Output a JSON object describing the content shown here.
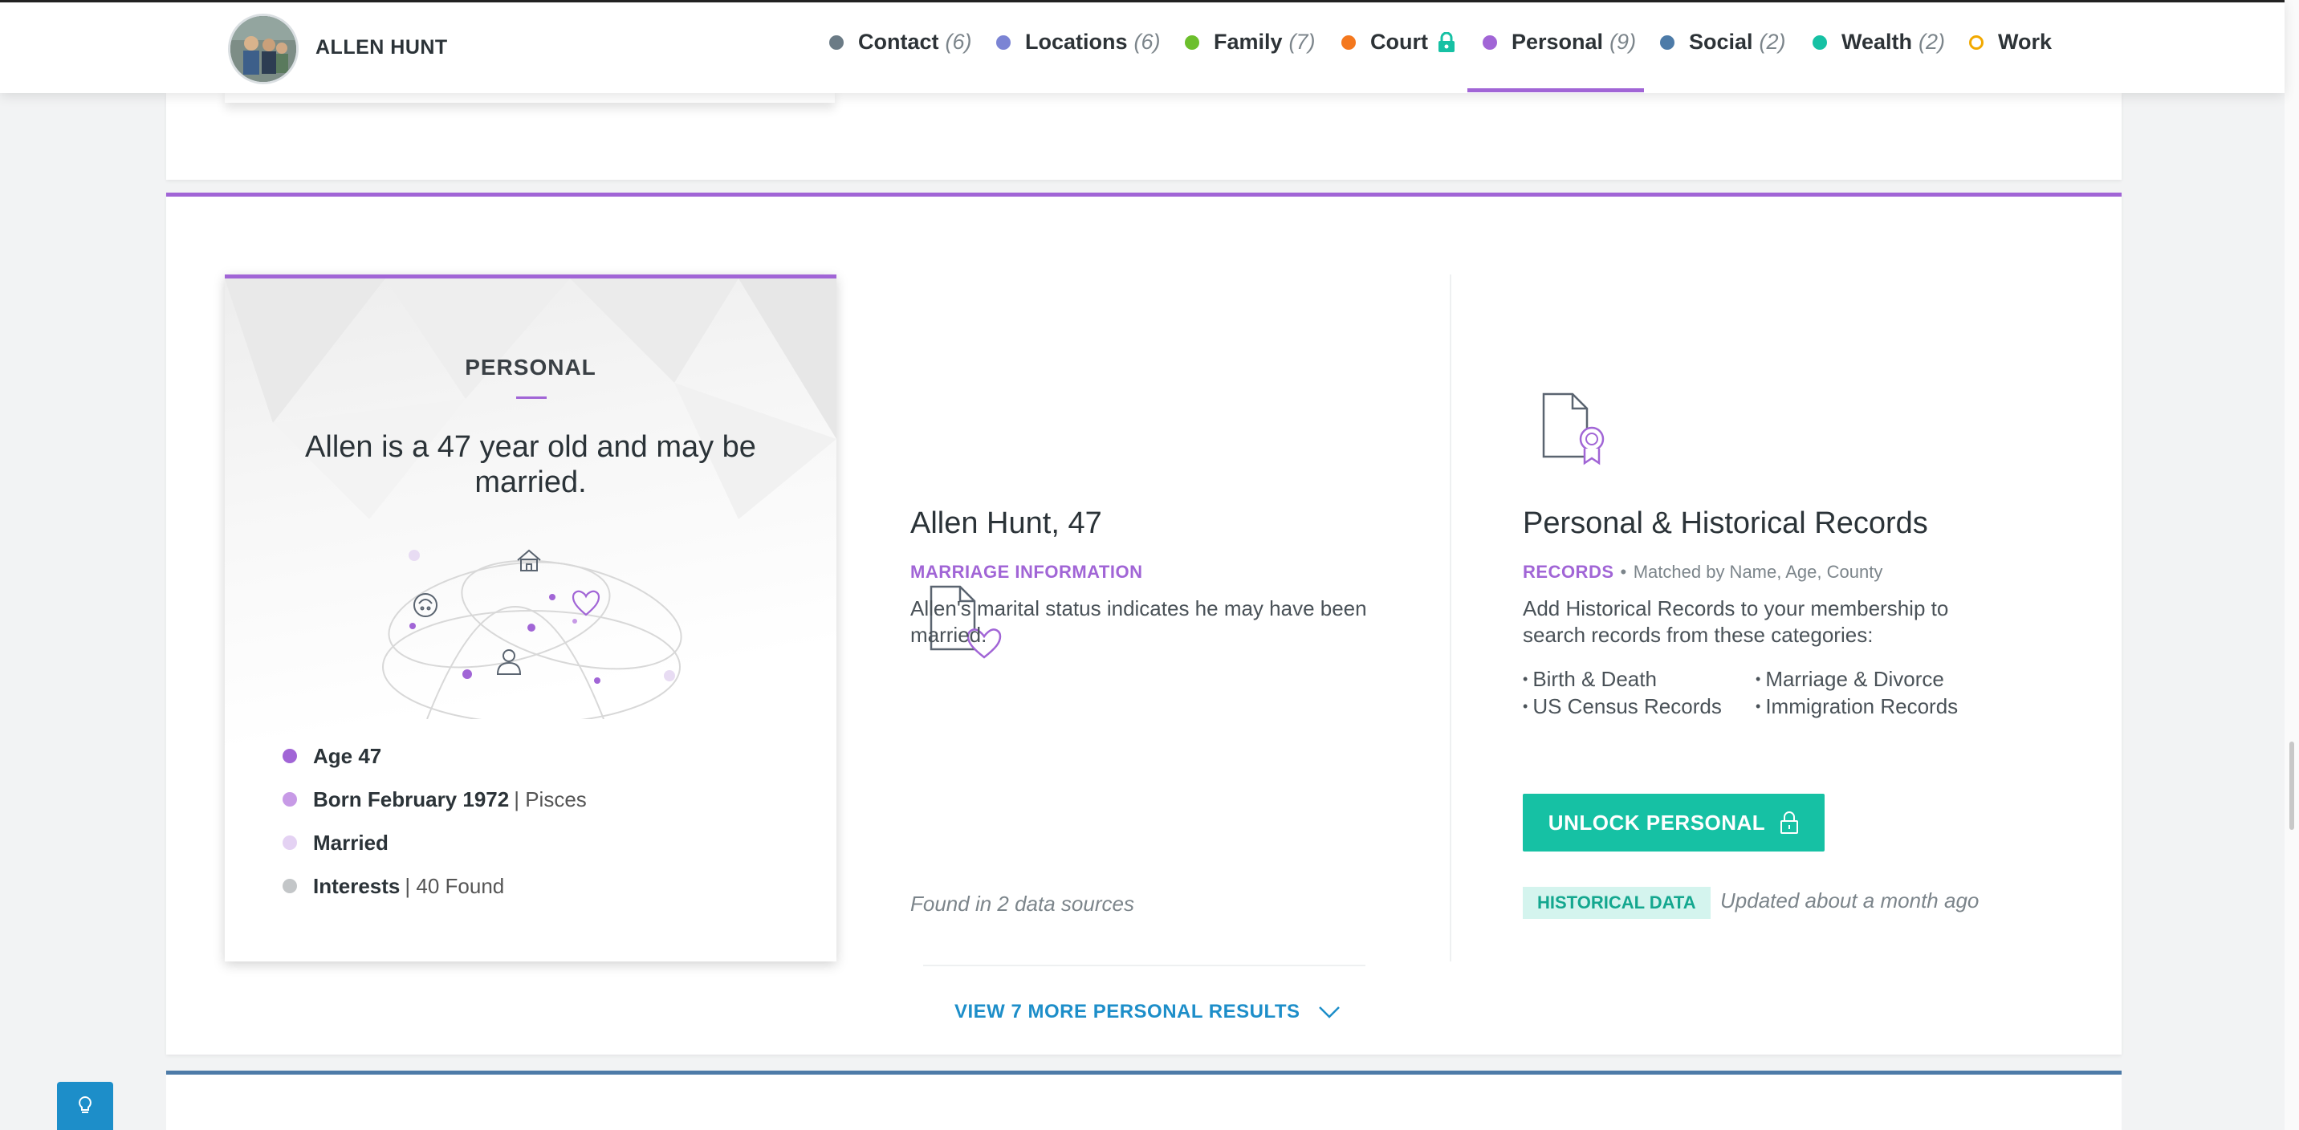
{
  "profile": {
    "name": "ALLEN HUNT"
  },
  "nav": {
    "items": [
      {
        "label": "Contact",
        "count": "(6)",
        "color": "#6b7b86"
      },
      {
        "label": "Locations",
        "count": "(6)",
        "color": "#7b84d4"
      },
      {
        "label": "Family",
        "count": "(7)",
        "color": "#6cbf2c"
      },
      {
        "label": "Court",
        "count": "",
        "color": "#f4781e",
        "locked": true
      },
      {
        "label": "Personal",
        "count": "(9)",
        "color": "#a165d6",
        "active": true
      },
      {
        "label": "Social",
        "count": "(2)",
        "color": "#4d7ba8"
      },
      {
        "label": "Wealth",
        "count": "(2)",
        "color": "#16c1a4"
      },
      {
        "label": "Work",
        "count": "",
        "color": "#f2a900",
        "hollow": true
      }
    ]
  },
  "summary": {
    "title": "PERSONAL",
    "text": "Allen is a 47 year old and may be married.",
    "facts": [
      {
        "strong": "Age 47",
        "sub": "",
        "color": "#a165d6"
      },
      {
        "strong": "Born February 1972",
        "sub": "| Pisces",
        "color": "#c79ae6"
      },
      {
        "strong": "Married",
        "sub": "",
        "color": "#e4d2f3"
      },
      {
        "strong": "Interests",
        "sub": "| 40 Found",
        "color": "#c3c6c8"
      }
    ]
  },
  "marriage": {
    "title": "Allen Hunt, 47",
    "category": "MARRIAGE INFORMATION",
    "description": "Allen's marital status indicates he may have been married.",
    "found": "Found in 2 data sources"
  },
  "records": {
    "title": "Personal & Historical Records",
    "category": "RECORDS",
    "separator": "•",
    "matched": "Matched by Name, Age, County",
    "description": "Add Historical Records to your membership to search records from these categories:",
    "bullets": [
      "Birth & Death",
      "Marriage & Divorce",
      "US Census Records",
      "Immigration Records"
    ],
    "unlock_label": "UNLOCK PERSONAL",
    "badge": "HISTORICAL DATA",
    "updated": "Updated about a month ago"
  },
  "view_more": {
    "label": "VIEW 7 MORE PERSONAL RESULTS"
  },
  "colors": {
    "personal": "#a165d6",
    "accent": "#16c1a4",
    "link": "#1d8ec9",
    "social": "#4d7ba8"
  }
}
